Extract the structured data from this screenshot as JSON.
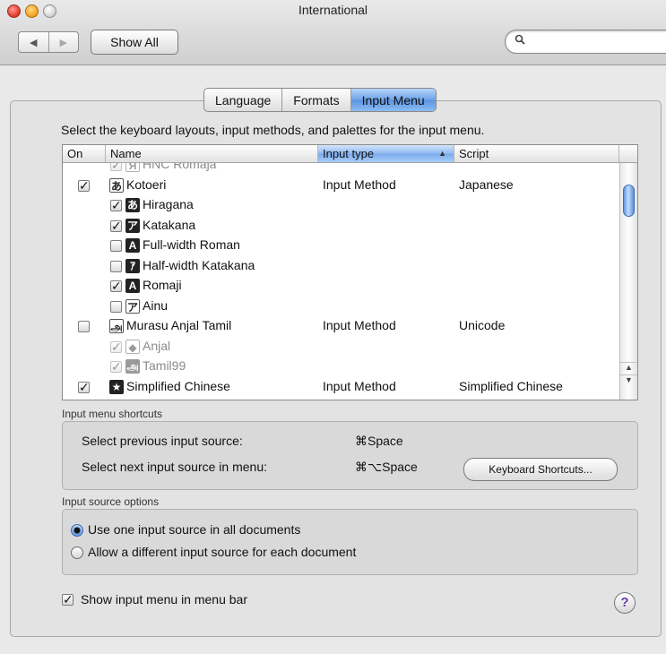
{
  "window": {
    "title": "International"
  },
  "toolbar": {
    "back": "◀",
    "forward": "▶",
    "show_all": "Show All",
    "search_placeholder": "",
    "search_icon": "magnifier-icon"
  },
  "tabs": [
    {
      "label": "Language",
      "active": false
    },
    {
      "label": "Formats",
      "active": false
    },
    {
      "label": "Input Menu",
      "active": true
    }
  ],
  "description": "Select the keyboard layouts, input methods, and palettes for the input menu.",
  "table": {
    "columns": {
      "on": "On",
      "name": "Name",
      "input_type": "Input type",
      "script": "Script"
    },
    "rows": [
      {
        "checked": true,
        "disabled": true,
        "indent": 1,
        "glyph": "Я",
        "glyph_style": "light",
        "name": "HNC Romaja",
        "input_type": "",
        "script": ""
      },
      {
        "checked": true,
        "disabled": false,
        "indent": 0,
        "glyph": "あ",
        "glyph_style": "light",
        "name": "Kotoeri",
        "input_type": "Input Method",
        "script": "Japanese"
      },
      {
        "checked": true,
        "disabled": false,
        "indent": 1,
        "glyph": "あ",
        "glyph_style": "dark",
        "name": "Hiragana",
        "input_type": "",
        "script": ""
      },
      {
        "checked": true,
        "disabled": false,
        "indent": 1,
        "glyph": "ア",
        "glyph_style": "dark",
        "name": "Katakana",
        "input_type": "",
        "script": ""
      },
      {
        "checked": false,
        "disabled": false,
        "indent": 1,
        "glyph": "A",
        "glyph_style": "dark",
        "name": "Full-width Roman",
        "input_type": "",
        "script": ""
      },
      {
        "checked": false,
        "disabled": false,
        "indent": 1,
        "glyph": "ｱ",
        "glyph_style": "dark",
        "name": "Half-width Katakana",
        "input_type": "",
        "script": ""
      },
      {
        "checked": true,
        "disabled": false,
        "indent": 1,
        "glyph": "A",
        "glyph_style": "dark",
        "name": "Romaji",
        "input_type": "",
        "script": ""
      },
      {
        "checked": false,
        "disabled": false,
        "indent": 1,
        "glyph": "ア",
        "glyph_style": "light",
        "name": "Ainu",
        "input_type": "",
        "script": ""
      },
      {
        "checked": false,
        "disabled": false,
        "indent": 0,
        "glyph": "அ",
        "glyph_style": "light",
        "name": "Murasu Anjal Tamil",
        "input_type": "Input Method",
        "script": "Unicode"
      },
      {
        "checked": true,
        "disabled": true,
        "indent": 1,
        "glyph": "◆",
        "glyph_style": "light",
        "name": "Anjal",
        "input_type": "",
        "script": ""
      },
      {
        "checked": true,
        "disabled": true,
        "indent": 1,
        "glyph": "அ",
        "glyph_style": "dark",
        "name": "Tamil99",
        "input_type": "",
        "script": ""
      },
      {
        "checked": true,
        "disabled": false,
        "indent": 0,
        "glyph": "★",
        "glyph_style": "dark",
        "name": "Simplified Chinese",
        "input_type": "Input Method",
        "script": "Simplified Chinese"
      }
    ]
  },
  "shortcuts": {
    "title": "Input menu shortcuts",
    "prev_label": "Select previous input source:",
    "prev_key": "⌘Space",
    "next_label": "Select next input source in menu:",
    "next_key": "⌘⌥Space",
    "button": "Keyboard Shortcuts..."
  },
  "options": {
    "title": "Input source options",
    "opt1": "Use one input source in all documents",
    "opt2": "Allow a different input source for each document",
    "selected": 1
  },
  "show_menu": {
    "label": "Show input menu in menu bar",
    "checked": true
  },
  "help": "?"
}
